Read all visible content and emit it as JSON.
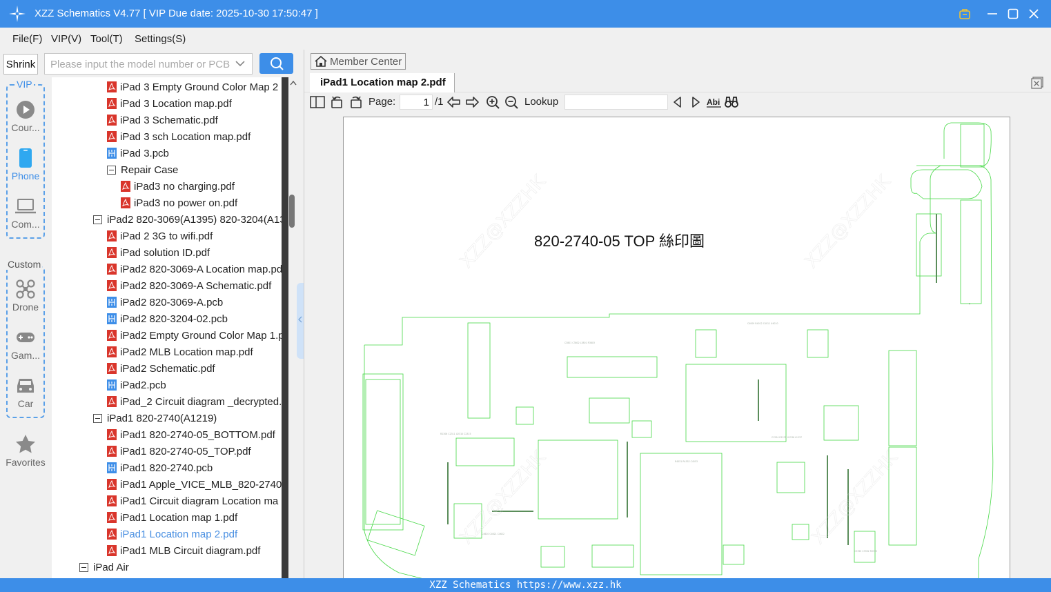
{
  "window": {
    "title": "XZZ Schematics V4.77 [ VIP Due date: 2025-10-30 17:50:47 ]"
  },
  "menu": [
    "File(F)",
    "VIP(V)",
    "Tool(T)",
    "Settings(S)"
  ],
  "search": {
    "shrink_label": "Shrink",
    "placeholder": "Please input the model number or PCB"
  },
  "categories": {
    "vip_label": "VIP",
    "vip_items": [
      {
        "label": "Cour...",
        "icon": "play-circle-icon"
      },
      {
        "label": "Phone",
        "icon": "phone-icon",
        "active": true
      },
      {
        "label": "Com...",
        "icon": "laptop-icon"
      }
    ],
    "custom_label": "Custom",
    "custom_items": [
      {
        "label": "Drone",
        "icon": "drone-icon"
      },
      {
        "label": "Gam...",
        "icon": "gamepad-icon"
      },
      {
        "label": "Car",
        "icon": "car-icon"
      }
    ],
    "favorites_label": "Favorites"
  },
  "tree": [
    {
      "label": "iPad 3 Empty Ground Color Map 2",
      "type": "pdf",
      "indent": 1
    },
    {
      "label": "iPad 3 Location map.pdf",
      "type": "pdf",
      "indent": 1
    },
    {
      "label": "iPad 3 Schematic.pdf",
      "type": "pdf",
      "indent": 1
    },
    {
      "label": "iPad 3 sch Location map.pdf",
      "type": "pdf",
      "indent": 1
    },
    {
      "label": "iPad 3.pcb",
      "type": "pcb",
      "indent": 1
    },
    {
      "label": "Repair Case",
      "type": "folder",
      "indent": 1
    },
    {
      "label": "iPad3 no charging.pdf",
      "type": "pdf",
      "indent": 2
    },
    {
      "label": "iPad3 no power on.pdf",
      "type": "pdf",
      "indent": 2
    },
    {
      "label": "iPad2 820-3069(A1395) 820-3204(A13",
      "type": "folder",
      "indent": 0
    },
    {
      "label": "iPad 2 3G to wifi.pdf",
      "type": "pdf",
      "indent": 1
    },
    {
      "label": "iPad solution ID.pdf",
      "type": "pdf",
      "indent": 1
    },
    {
      "label": "iPad2 820-3069-A Location map.pd",
      "type": "pdf",
      "indent": 1
    },
    {
      "label": "iPad2 820-3069-A Schematic.pdf",
      "type": "pdf",
      "indent": 1
    },
    {
      "label": "iPad2 820-3069-A.pcb",
      "type": "pcb",
      "indent": 1
    },
    {
      "label": "iPad2 820-3204-02.pcb",
      "type": "pcb",
      "indent": 1
    },
    {
      "label": "iPad2 Empty Ground Color Map 1.p",
      "type": "pdf",
      "indent": 1
    },
    {
      "label": "iPad2 MLB Location map.pdf",
      "type": "pdf",
      "indent": 1
    },
    {
      "label": "iPad2 Schematic.pdf",
      "type": "pdf",
      "indent": 1
    },
    {
      "label": "iPad2.pcb",
      "type": "pcb",
      "indent": 1
    },
    {
      "label": "iPad_2 Circuit diagram _decrypted.",
      "type": "pdf",
      "indent": 1
    },
    {
      "label": "iPad1 820-2740(A1219)",
      "type": "folder",
      "indent": 0
    },
    {
      "label": "iPad1 820-2740-05_BOTTOM.pdf",
      "type": "pdf",
      "indent": 1
    },
    {
      "label": "iPad1 820-2740-05_TOP.pdf",
      "type": "pdf",
      "indent": 1
    },
    {
      "label": "iPad1 820-2740.pcb",
      "type": "pcb",
      "indent": 1
    },
    {
      "label": "iPad1 Apple_VICE_MLB_820-2740-/",
      "type": "pdf",
      "indent": 1
    },
    {
      "label": "iPad1 Circuit diagram Location ma",
      "type": "pdf",
      "indent": 1
    },
    {
      "label": "iPad1 Location map 1.pdf",
      "type": "pdf",
      "indent": 1
    },
    {
      "label": "iPad1 Location map 2.pdf",
      "type": "pdf",
      "indent": 1,
      "active": true
    },
    {
      "label": "iPad1 MLB Circuit diagram.pdf",
      "type": "pdf",
      "indent": 1
    },
    {
      "label": "iPad Air",
      "type": "folder",
      "indent": -1
    }
  ],
  "viewer": {
    "member_center": "Member Center",
    "tab_title": "iPad1 Location map 2.pdf",
    "page_label": "Page:",
    "page_current": "1",
    "page_total": "/1",
    "lookup_label": "Lookup",
    "page_heading": "820-2740-05 TOP 絲印圖",
    "watermark": "XZZ@XZZHK"
  },
  "statusbar": "XZZ Schematics https://www.xzz.hk",
  "colors": {
    "accent": "#3d8ee8",
    "pdf_icon": "#d9352b",
    "pcb_icon": "#3d8ee8",
    "board_outline": "#3ad63a"
  }
}
